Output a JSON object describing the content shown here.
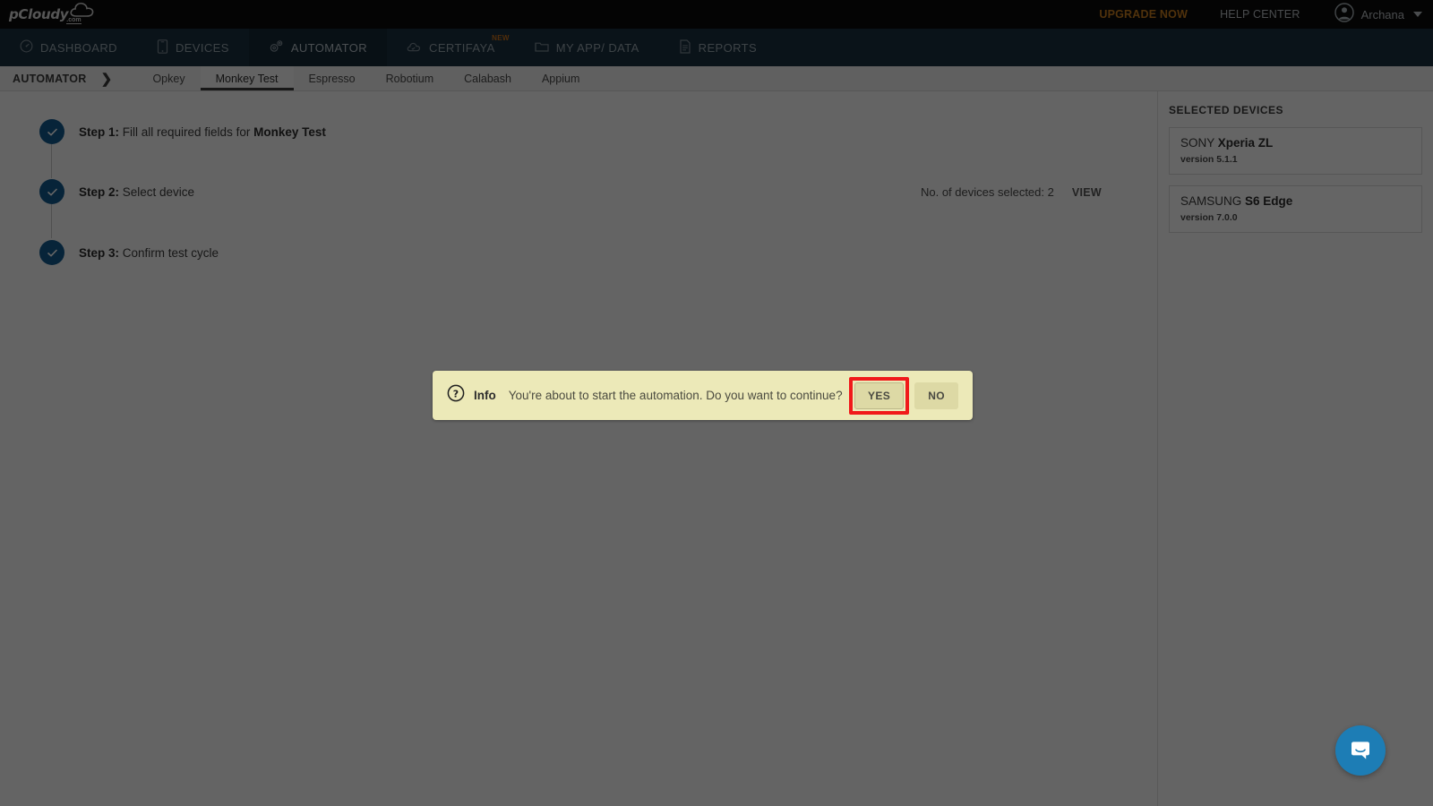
{
  "brand": {
    "logo_text": "pCloudy",
    "logo_suffix": ".com",
    "logo_icon": "cloud-icon"
  },
  "topbar": {
    "upgrade_label": "UPGRADE NOW",
    "help_label": "HELP CENTER",
    "user_name": "Archana",
    "avatar_icon": "user-avatar-icon",
    "caret_icon": "chevron-down-icon"
  },
  "mainnav": {
    "items": [
      {
        "label": "DASHBOARD",
        "icon": "speedometer-icon",
        "active": false,
        "badge": ""
      },
      {
        "label": "DEVICES",
        "icon": "mobile-phone-icon",
        "active": false,
        "badge": ""
      },
      {
        "label": "AUTOMATOR",
        "icon": "gears-icon",
        "active": true,
        "badge": ""
      },
      {
        "label": "CERTIFAYA",
        "icon": "cloud-check-icon",
        "active": false,
        "badge": "NEW"
      },
      {
        "label": "MY APP/ DATA",
        "icon": "folder-icon",
        "active": false,
        "badge": ""
      },
      {
        "label": "REPORTS",
        "icon": "document-icon",
        "active": false,
        "badge": ""
      }
    ]
  },
  "subnav": {
    "title": "AUTOMATOR",
    "arrow_icon": "chevron-right-icon",
    "tabs": [
      {
        "label": "Opkey",
        "active": false
      },
      {
        "label": "Monkey Test",
        "active": true
      },
      {
        "label": "Espresso",
        "active": false
      },
      {
        "label": "Robotium",
        "active": false
      },
      {
        "label": "Calabash",
        "active": false
      },
      {
        "label": "Appium",
        "active": false
      }
    ]
  },
  "steps": [
    {
      "number": "Step 1:",
      "text": " Fill all required fields for ",
      "strong": "Monkey Test",
      "icon": "check-icon",
      "complete": true
    },
    {
      "number": "Step 2:",
      "text": " Select device",
      "strong": "",
      "icon": "check-icon",
      "complete": true
    },
    {
      "number": "Step 3:",
      "text": " Confirm test cycle",
      "strong": "",
      "icon": "check-icon",
      "complete": true
    }
  ],
  "devices_summary": {
    "count_label": "No. of devices selected: 2",
    "view_label": "VIEW"
  },
  "selected_devices_panel": {
    "title": "SELECTED DEVICES",
    "devices": [
      {
        "brand": "SONY ",
        "model": "Xperia ZL",
        "version": "version 5.1.1"
      },
      {
        "brand": "SAMSUNG ",
        "model": "S6 Edge",
        "version": "version 7.0.0"
      }
    ]
  },
  "modal": {
    "icon": "question-mark-circle-icon",
    "title": "Info",
    "message": "You're about to start the automation. Do you want to continue?",
    "yes_label": "YES",
    "no_label": "NO",
    "highlight_color": "#f01a1a",
    "background_color": "#ece9b8"
  },
  "intercom": {
    "icon": "chat-bubble-icon",
    "color": "#1d7db5"
  }
}
